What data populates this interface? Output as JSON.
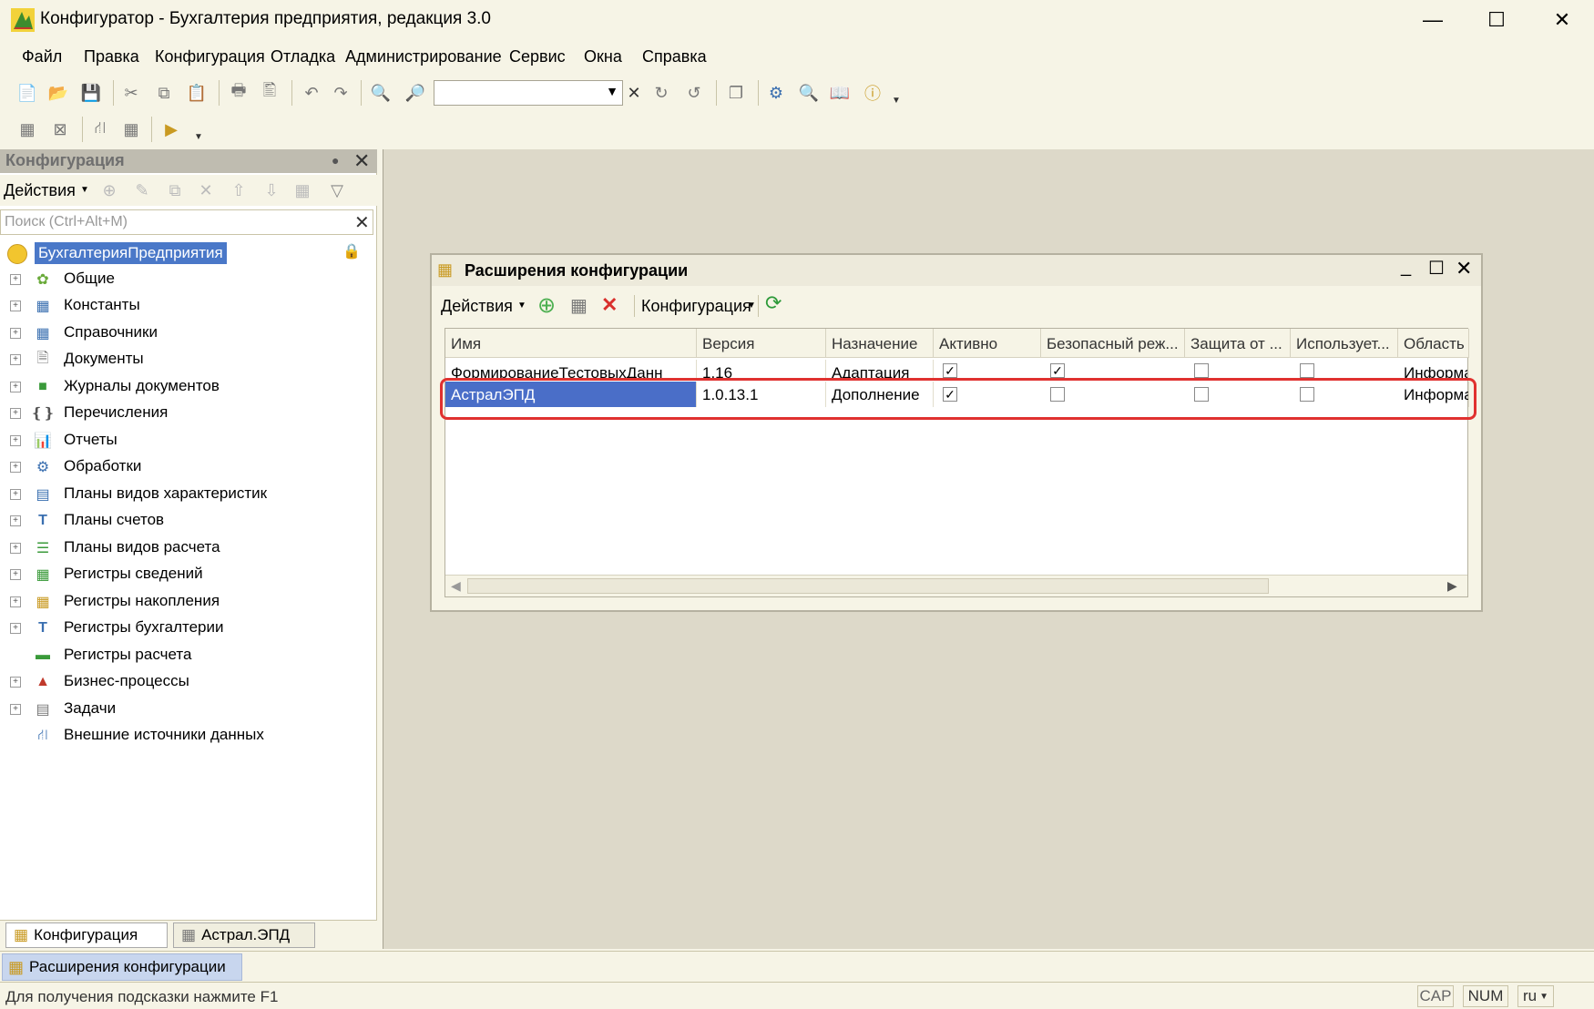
{
  "window": {
    "title": "Конфигуратор - Бухгалтерия предприятия, редакция 3.0"
  },
  "menu": [
    "Файл",
    "Правка",
    "Конфигурация",
    "Отладка",
    "Администрирование",
    "Сервис",
    "Окна",
    "Справка"
  ],
  "config_panel": {
    "title": "Конфигурация",
    "actions_label": "Действия",
    "search_placeholder": "Поиск (Ctrl+Alt+M)",
    "root": "БухгалтерияПредприятия",
    "items": [
      "Общие",
      "Константы",
      "Справочники",
      "Документы",
      "Журналы документов",
      "Перечисления",
      "Отчеты",
      "Обработки",
      "Планы видов характеристик",
      "Планы счетов",
      "Планы видов расчета",
      "Регистры сведений",
      "Регистры накопления",
      "Регистры бухгалтерии",
      "Регистры расчета",
      "Бизнес-процессы",
      "Задачи",
      "Внешние источники данных"
    ],
    "tabs": [
      "Конфигурация",
      "Астрал.ЭПД"
    ]
  },
  "dialog": {
    "title": "Расширения конфигурации",
    "actions_label": "Действия",
    "config_label": "Конфигурация",
    "columns": [
      "Имя",
      "Версия",
      "Назначение",
      "Активно",
      "Безопасный реж...",
      "Защита от ...",
      "Использует...",
      "Область ..."
    ],
    "rows": [
      {
        "name": "ФормированиеТестовыхДанн",
        "version": "1.16",
        "purpose": "Адаптация",
        "active": true,
        "safe_mode": true,
        "protection": false,
        "uses": false,
        "area": "Информа"
      },
      {
        "name": "АстралЭПД",
        "version": "1.0.13.1",
        "purpose": "Дополнение",
        "active": true,
        "safe_mode": false,
        "protection": false,
        "uses": false,
        "area": "Информа"
      }
    ],
    "highlight_color": "#e0312f"
  },
  "taskbar": {
    "item": "Расширения конфигурации"
  },
  "status": {
    "hint": "Для получения подсказки нажмите F1",
    "cap": "CAP",
    "num": "NUM",
    "lang": "ru"
  }
}
